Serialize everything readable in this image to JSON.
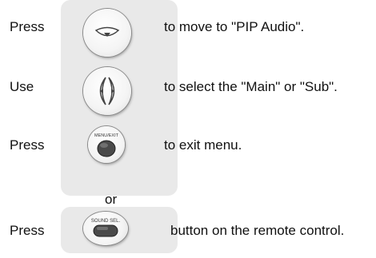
{
  "steps": [
    {
      "lead": "Press",
      "text": "to move to \"PIP Audio\".",
      "icon": "down-arrow-button-icon"
    },
    {
      "lead": "Use",
      "text": "to select the \"Main\" or \"Sub\".",
      "icon": "left-right-button-icon"
    },
    {
      "lead": "Press",
      "text": "to exit menu.",
      "icon": "menu-exit-button-icon",
      "button_label": "MENU/EXIT"
    },
    {
      "lead": "Press",
      "text": "button on the remote control.",
      "icon": "sound-sel-button-icon",
      "button_label": "SOUND SEL."
    }
  ],
  "or_label": "or"
}
